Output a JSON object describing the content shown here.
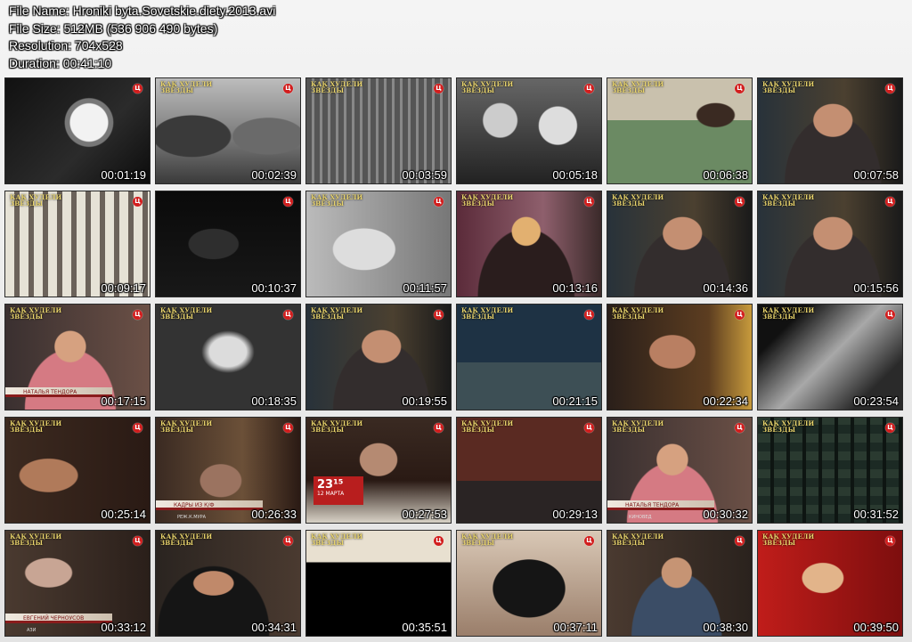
{
  "info": {
    "file_name": "File Name: Hroniki byta.Sovetskie.diety.2013.avi",
    "file_size": "File Size: 512MB (536 906 490 bytes)",
    "resolution": "Resolution: 704x528",
    "duration": "Duration: 00:41:10"
  },
  "logo_text": "КАК ХУДЕЛИ\nЗВЁЗДЫ",
  "channel_icon_glyph": "Ц",
  "thumbnails": [
    {
      "time": "00:01:19",
      "scene": "gauge",
      "logo": false
    },
    {
      "time": "00:02:39",
      "scene": "bw-people",
      "logo": true
    },
    {
      "time": "00:03:59",
      "scene": "bw-factory",
      "logo": true
    },
    {
      "time": "00:05:18",
      "scene": "bw-children",
      "logo": true
    },
    {
      "time": "00:06:38",
      "scene": "bath",
      "logo": true
    },
    {
      "time": "00:07:58",
      "scene": "man",
      "logo": true
    },
    {
      "time": "00:09:17",
      "scene": "jars",
      "logo": true
    },
    {
      "time": "00:10:37",
      "scene": "dark",
      "logo": false
    },
    {
      "time": "00:11:57",
      "scene": "bw-scale",
      "logo": true
    },
    {
      "time": "00:13:16",
      "scene": "woman-blonde",
      "logo": true
    },
    {
      "time": "00:14:36",
      "scene": "man",
      "logo": true
    },
    {
      "time": "00:15:56",
      "scene": "man",
      "logo": true
    },
    {
      "time": "00:17:15",
      "scene": "woman-red",
      "logo": true,
      "lower_third": "НАТАЛЬЯ ТЕНДОРА"
    },
    {
      "time": "00:18:35",
      "scene": "bw-arch",
      "logo": true
    },
    {
      "time": "00:19:55",
      "scene": "man",
      "logo": true
    },
    {
      "time": "00:21:15",
      "scene": "stage",
      "logo": true
    },
    {
      "time": "00:22:34",
      "scene": "man-glasses",
      "logo": true
    },
    {
      "time": "00:23:54",
      "scene": "bw-closeup",
      "logo": true
    },
    {
      "time": "00:25:14",
      "scene": "young-man",
      "logo": true
    },
    {
      "time": "00:26:33",
      "scene": "film-scene",
      "logo": true,
      "lower_third": "КАДРЫ ИЗ К/Ф",
      "lower_third_sub": "РЕЖ.К.МУРА"
    },
    {
      "time": "00:27:53",
      "scene": "man-white",
      "logo": true,
      "date_badge": "23¹⁵",
      "date_sub": "12 МАРТА"
    },
    {
      "time": "00:29:13",
      "scene": "dancers",
      "logo": true
    },
    {
      "time": "00:30:32",
      "scene": "woman-red",
      "logo": true,
      "lower_third": "НАТАЛЬЯ ТЕНДОРА",
      "lower_third_sub": "КИНОВЕД"
    },
    {
      "time": "00:31:52",
      "scene": "building",
      "logo": true
    },
    {
      "time": "00:33:12",
      "scene": "old-man",
      "logo": true,
      "lower_third": "ЕВГЕНИЙ ЧЕРНОУСОВ",
      "lower_third_sub": "АЗИ"
    },
    {
      "time": "00:34:31",
      "scene": "woman-dark",
      "logo": true
    },
    {
      "time": "00:35:51",
      "scene": "poster",
      "logo": true
    },
    {
      "time": "00:37:11",
      "scene": "sunglasses",
      "logo": true
    },
    {
      "time": "00:38:30",
      "scene": "woman-scarf",
      "logo": true
    },
    {
      "time": "00:39:50",
      "scene": "red-man",
      "logo": true
    }
  ]
}
